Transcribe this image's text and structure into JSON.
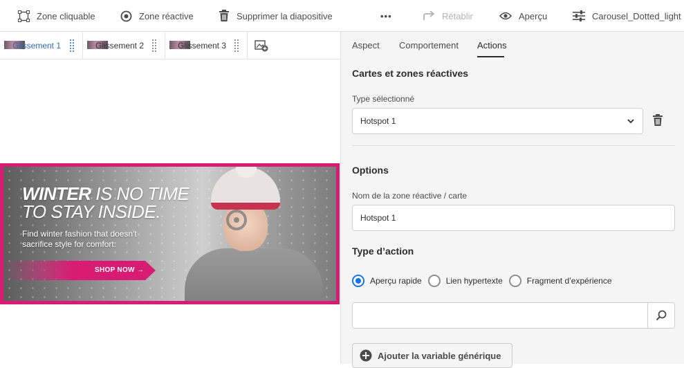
{
  "toolbar": {
    "clickable_zone": "Zone cliquable",
    "hotspot": "Zone réactive",
    "delete_slide": "Supprimer la diapositive",
    "more": "•••",
    "redo": "Rétablir",
    "preview": "Aperçu",
    "preset": "Carousel_Dotted_light"
  },
  "slides": [
    {
      "label": "Glissement 1",
      "active": true
    },
    {
      "label": "Glissement 2",
      "active": false
    },
    {
      "label": "Glissement 3",
      "active": false
    }
  ],
  "banner": {
    "headline_bold_1": "WINTER",
    "headline_rest_1": " IS NO TIME",
    "headline_2": "TO STAY INSIDE.",
    "subline": "Find winter fashion that doesn't sacrifice style for comfort.",
    "cta": "SHOP NOW →"
  },
  "panel": {
    "tabs": [
      "Aspect",
      "Comportement",
      "Actions"
    ],
    "active_tab": "Actions",
    "section_title": "Cartes et zones réactives",
    "selected_type_label": "Type sélectionné",
    "selected_type_value": "Hotspot 1",
    "options_title": "Options",
    "name_label": "Nom de la zone réactive / carte",
    "name_value": "Hotspot 1",
    "action_type_title": "Type d’action",
    "action_options": [
      {
        "label": "Aperçu rapide",
        "selected": true
      },
      {
        "label": "Lien hypertexte",
        "selected": false
      },
      {
        "label": "Fragment d’expérience",
        "selected": false
      }
    ],
    "search_value": "",
    "add_variable": "Ajouter la variable générique"
  },
  "colors": {
    "accent": "#1473e6",
    "banner_border": "#d81c74",
    "active_slide": "#2d6bb4"
  }
}
